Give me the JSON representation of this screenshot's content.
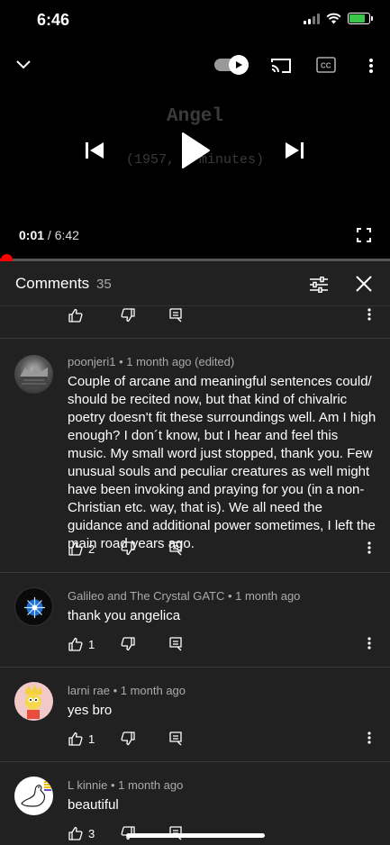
{
  "status": {
    "time": "6:46"
  },
  "player": {
    "video_title": "Angel",
    "video_subtitle": "(1957, 6 minutes)",
    "current_time": "0:01",
    "separator": "/",
    "duration": "6:42",
    "progress": 0.003
  },
  "comments": {
    "title": "Comments",
    "count": "35",
    "items": [
      {
        "author_meta": "poonjeri1 • 1 month ago (edited)",
        "text": "Couple of arcane and meaningful sentences could/ should be recited now, but that kind of chivalric poetry doesn't fit these surroundings well. Am I high enough? I don´t know, but I hear and feel this music. My small word just stopped, thank you. Few unusual souls and peculiar creatures as well might have been invoking and praying for you (in a non-Christian etc. way, that is). We all need the guidance and additional power sometimes, I left the main road years ago.",
        "likes": "2"
      },
      {
        "author_meta": "Galileo and The Crystal GATC • 1 month ago",
        "text": "thank you angelica",
        "likes": "1"
      },
      {
        "author_meta": "larni rae • 1 month ago",
        "text": "yes bro",
        "likes": "1"
      },
      {
        "author_meta": "L kinnie • 1 month ago",
        "text": "beautiful",
        "likes": "3"
      }
    ]
  }
}
